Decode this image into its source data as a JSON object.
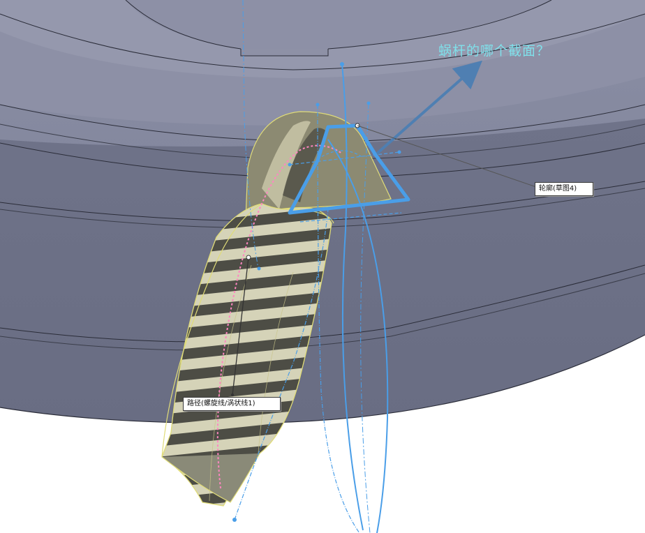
{
  "annotation": {
    "question": "蜗杆的哪个截面？",
    "color": "#7fe0ea"
  },
  "callouts": {
    "profile_label": "轮廓(草图4)",
    "path_label": "路径(螺旋线/涡状线1)"
  },
  "colors": {
    "part_body": "#7b7f96",
    "part_face_light": "#9497ab",
    "sketch_blue": "#4a9ee8",
    "highlight_yellow": "#e0dc78",
    "path_pink": "#ff86c0",
    "arrow": "#4f7fb2"
  }
}
